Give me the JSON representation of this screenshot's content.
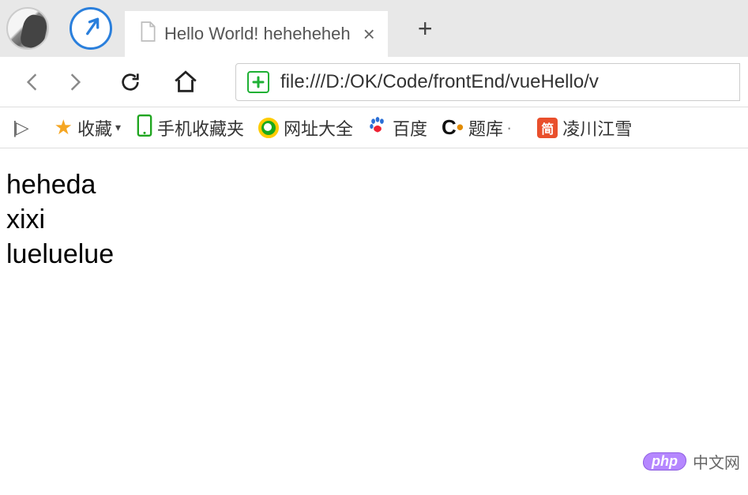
{
  "tab": {
    "title": "Hello World! heheheheh",
    "close_glyph": "×"
  },
  "new_tab_glyph": "+",
  "urlbar": {
    "url": "file:///D:/OK/Code/frontEnd/vueHello/v",
    "shield_glyph": "+"
  },
  "bookmarks": {
    "sidebar_glyph": "|▷",
    "fav": "收藏",
    "mobile": "手机收藏夹",
    "sites": "网址大全",
    "baidu": "百度",
    "tiku": "题库",
    "jian": "简",
    "lingchuan": "凌川江雪"
  },
  "page": {
    "lines": [
      "heheda",
      "xixi",
      "lueluelue"
    ]
  },
  "watermark": {
    "pill": "php",
    "text": "中文网"
  }
}
